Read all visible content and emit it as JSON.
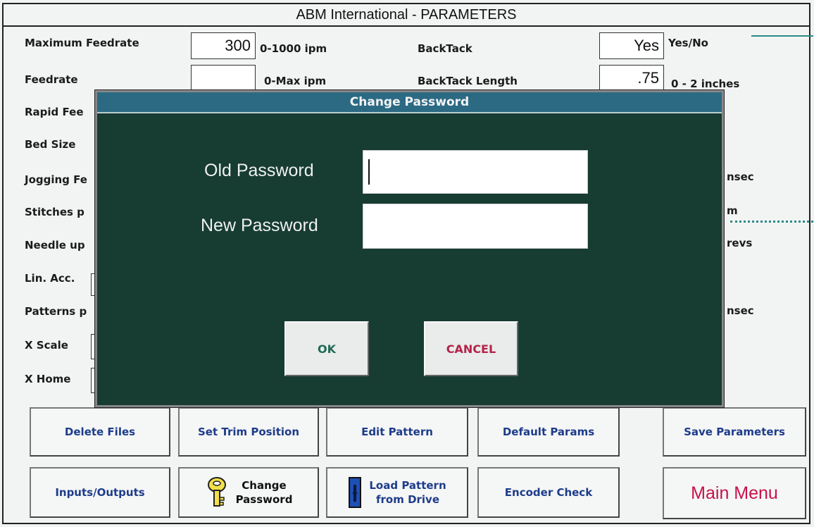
{
  "window": {
    "title": "ABM International - PARAMETERS"
  },
  "params_left": [
    {
      "label": "Maximum Feedrate",
      "value": "300",
      "unit": "0-1000 ipm"
    },
    {
      "label": "Feedrate",
      "value": "",
      "unit": "0-Max ipm"
    },
    {
      "label": "Rapid Fee"
    },
    {
      "label": "Bed Size"
    },
    {
      "label": "Jogging Fe"
    },
    {
      "label": "Stitches p"
    },
    {
      "label": "Needle up"
    },
    {
      "label": "Lin. Acc."
    },
    {
      "label": "Patterns p"
    },
    {
      "label": "X Scale"
    },
    {
      "label": "X Home"
    }
  ],
  "params_right": [
    {
      "label": "BackTack",
      "value": "Yes",
      "unit": "Yes/No"
    },
    {
      "label": "BackTack Length",
      "value": ".75",
      "unit": "0 - 2 inches"
    }
  ],
  "right_units": [
    "nsec",
    "m",
    "revs",
    "nsec"
  ],
  "dialog": {
    "title": "Change Password",
    "old_label": "Old Password",
    "new_label": "New Password",
    "old_value": "",
    "new_value": "",
    "ok_label": "OK",
    "cancel_label": "CANCEL"
  },
  "buttons_row1": [
    "Delete Files",
    "Set Trim Position",
    "Edit Pattern",
    "Default Params",
    "Save Parameters"
  ],
  "buttons_row2": {
    "inputs_outputs": "Inputs/Outputs",
    "change_password_1": "Change",
    "change_password_2": "Password",
    "load_pattern_1": "Load Pattern",
    "load_pattern_2": "from Drive",
    "encoder_check": "Encoder Check",
    "main_menu": "Main Menu"
  },
  "colors": {
    "dialog_bg": "#173c32",
    "dialog_title_bg": "#2c6a84",
    "button_text": "#1d3c8a",
    "main_menu_text": "#c8114a",
    "ok_text": "#1f6a55",
    "cancel_text": "#b3224a"
  }
}
